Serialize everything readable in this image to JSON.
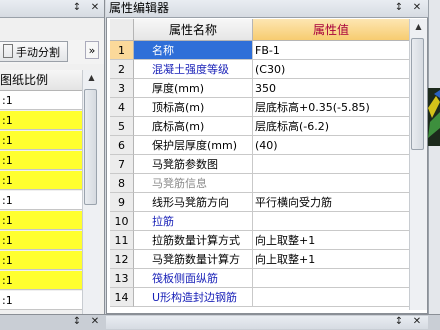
{
  "left_panel": {
    "pin_icon": "pin-icon",
    "close_icon": "close-icon",
    "split_button_label": "手动分割",
    "more_label": "»",
    "column_header": "图纸比例",
    "rows": [
      {
        "value": ":1",
        "highlight": "white"
      },
      {
        "value": ":1",
        "highlight": "yellow"
      },
      {
        "value": ":1",
        "highlight": "yellow"
      },
      {
        "value": ":1",
        "highlight": "yellow"
      },
      {
        "value": ":1",
        "highlight": "yellow"
      },
      {
        "value": ":1",
        "highlight": "white"
      },
      {
        "value": ":1",
        "highlight": "yellow"
      },
      {
        "value": ":1",
        "highlight": "yellow"
      },
      {
        "value": ":1",
        "highlight": "yellow"
      },
      {
        "value": ":1",
        "highlight": "yellow"
      },
      {
        "value": ":1",
        "highlight": "white"
      }
    ]
  },
  "property_editor": {
    "title": "属性编辑器",
    "pin_icon": "pin-icon",
    "close_icon": "close-icon",
    "col_name": "属性名称",
    "col_value": "属性值",
    "selected_row": 1,
    "rows": [
      {
        "index": "1",
        "name": "名称",
        "value": "FB-1",
        "style": "blue"
      },
      {
        "index": "2",
        "name": "混凝土强度等级",
        "value": "(C30)",
        "style": "blue"
      },
      {
        "index": "3",
        "name": "厚度(mm)",
        "value": "350",
        "style": "normal"
      },
      {
        "index": "4",
        "name": "顶标高(m)",
        "value": "层底标高+0.35(-5.85)",
        "style": "normal"
      },
      {
        "index": "5",
        "name": "底标高(m)",
        "value": "层底标高(-6.2)",
        "style": "normal"
      },
      {
        "index": "6",
        "name": "保护层厚度(mm)",
        "value": "(40)",
        "style": "normal"
      },
      {
        "index": "7",
        "name": "马凳筋参数图",
        "value": "",
        "style": "normal"
      },
      {
        "index": "8",
        "name": "马凳筋信息",
        "value": "",
        "style": "grey"
      },
      {
        "index": "9",
        "name": "线形马凳筋方向",
        "value": "平行横向受力筋",
        "style": "normal"
      },
      {
        "index": "10",
        "name": "拉筋",
        "value": "",
        "style": "blue"
      },
      {
        "index": "11",
        "name": "拉筋数量计算方式",
        "value": "向上取整+1",
        "style": "normal"
      },
      {
        "index": "12",
        "name": "马凳筋数量计算方",
        "value": "向上取整+1",
        "style": "normal"
      },
      {
        "index": "13",
        "name": "筏板侧面纵筋",
        "value": "",
        "style": "blue"
      },
      {
        "index": "14",
        "name": "U形构造封边钢筋",
        "value": "",
        "style": "blue"
      }
    ]
  },
  "bottom_panel": {
    "pin_icon": "pin-icon",
    "close_icon": "close-icon"
  },
  "colors": {
    "selected_row_bg": "#2f6fd8",
    "value_header_bg": "#f7cc70",
    "value_header_text": "#a8003c",
    "highlight_yellow": "#ffff2e",
    "blue_text": "#1a22b8"
  }
}
